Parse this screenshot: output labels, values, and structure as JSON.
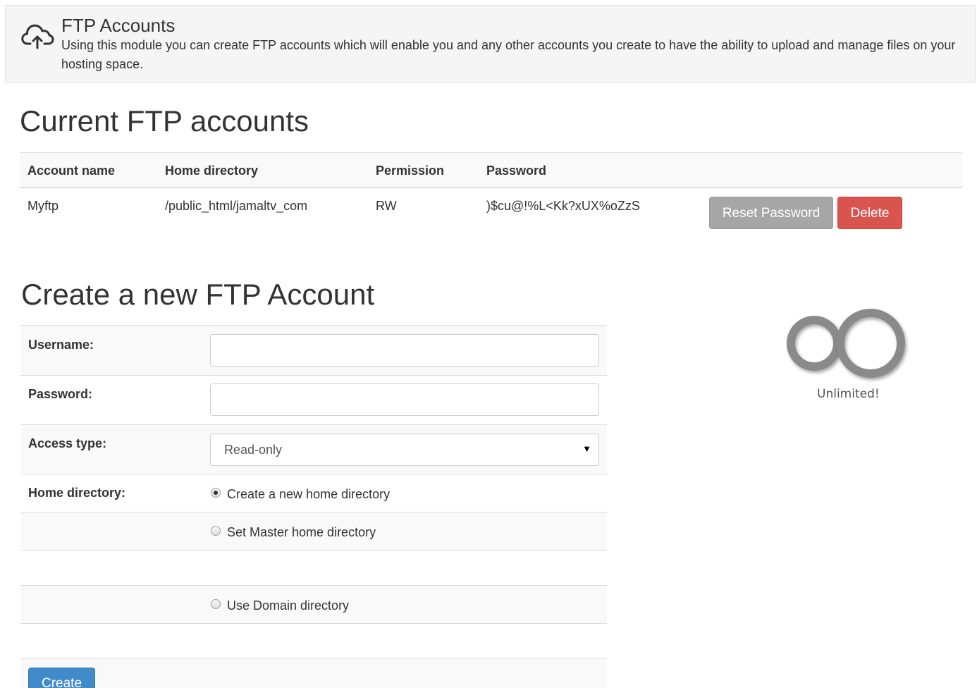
{
  "header": {
    "icon": "cloud-upload-icon",
    "title": "FTP Accounts",
    "description": "Using this module you can create FTP accounts which will enable you and any other accounts you create to have the ability to upload and manage files on your hosting space."
  },
  "current": {
    "heading": "Current FTP accounts",
    "columns": [
      "Account name",
      "Home directory",
      "Permission",
      "Password"
    ],
    "rows": [
      {
        "account_name": "Myftp",
        "home_directory": "/public_html/jamaltv_com",
        "permission": "RW",
        "password": ")$cu@!%L<Kk?xUX%oZzS",
        "reset_label": "Reset Password",
        "delete_label": "Delete"
      }
    ]
  },
  "create": {
    "heading": "Create a new FTP Account",
    "username_label": "Username:",
    "username_value": "",
    "password_label": "Password:",
    "password_value": "",
    "access_label": "Access type:",
    "access_value": "Read-only",
    "home_label": "Home directory:",
    "home_options": [
      {
        "label": "Create a new home directory",
        "checked": true
      },
      {
        "label": "Set Master home directory",
        "checked": false
      },
      {
        "label": "Use Domain directory",
        "checked": false
      }
    ],
    "create_label": "Create"
  },
  "quota": {
    "icon": "infinity-icon",
    "label": "Unlimited!"
  },
  "colors": {
    "header_bg": "#f5f5f5",
    "reset_button": "#a6a6a6",
    "delete_button": "#d9534f",
    "create_button": "#428bca"
  }
}
